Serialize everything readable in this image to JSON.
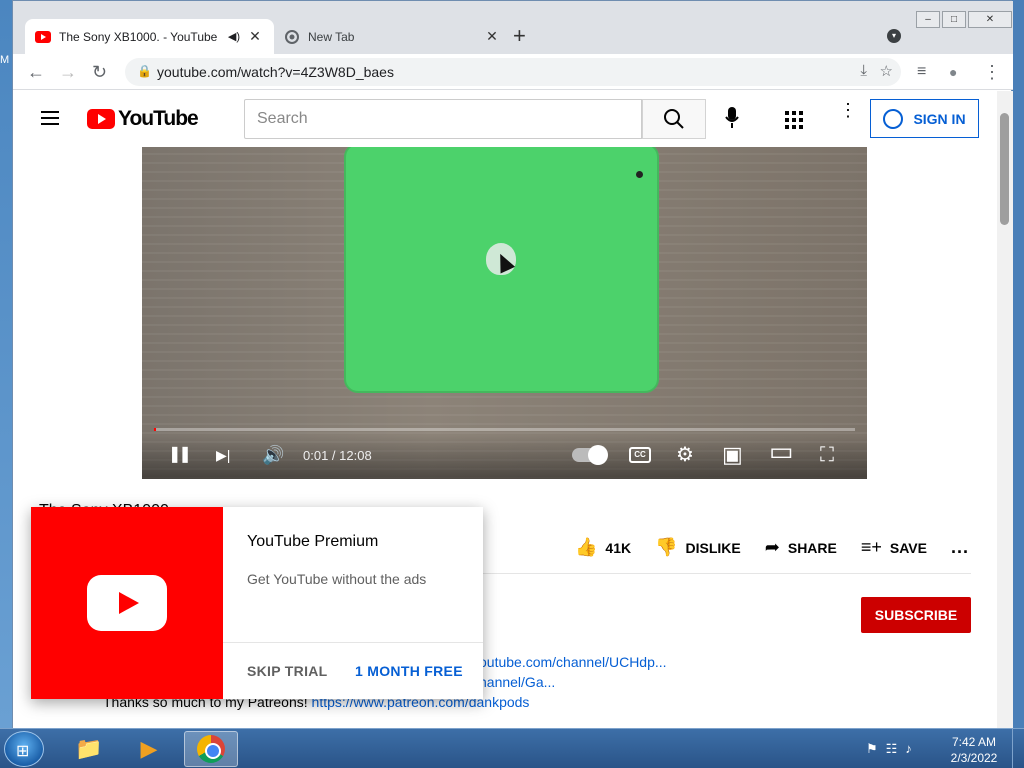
{
  "desktop": {
    "edge_letter": "M"
  },
  "browser": {
    "tabs": [
      {
        "title": "The Sony XB1000. - YouTube",
        "active": true,
        "audio": "◀)",
        "close": "✕"
      },
      {
        "title": "New Tab",
        "active": false,
        "close": "✕"
      }
    ],
    "new_tab": "+",
    "tab_search": "▾",
    "window_controls": {
      "minimize": "–",
      "maximize": "□",
      "close": "✕"
    },
    "nav": {
      "back": "←",
      "forward": "→",
      "reload": "↻"
    },
    "address": {
      "lock": "🔒",
      "url": "youtube.com/watch?v=4Z3W8D_baes",
      "install": "⤓",
      "star": "☆"
    },
    "right_icons": {
      "media": "≡",
      "profile": "●",
      "menu": "⋮"
    }
  },
  "youtube": {
    "logo_text": "YouTube",
    "search_placeholder": "Search",
    "search_icon": "⚲",
    "mic_icon": "🎤",
    "more_icon": "⋮",
    "sign_in": "SIGN IN",
    "player": {
      "time": "0:01 / 12:08",
      "progress": 0.002,
      "pause_icon": "❚❚",
      "next_icon": "▶|",
      "volume_icon": "🔊",
      "cc_label": "CC",
      "settings_icon": "⚙",
      "miniplayer_icon": "▣",
      "theater_icon": "▭",
      "fullscreen_icon": "⛶"
    },
    "video_title": "The Sony XB1000.",
    "actions": [
      {
        "icon": "👍",
        "label": "41K"
      },
      {
        "icon": "👎",
        "label": "DISLIKE"
      },
      {
        "icon": "➦",
        "label": "SHARE"
      },
      {
        "icon": "≡+",
        "label": "SAVE"
      }
    ],
    "more_actions": "...",
    "subscribe": "SUBSCRIBE",
    "description": {
      "link1": "outube.com/channel/UCHdp...",
      "link2": "hannel/Ga...",
      "patreon_text": "Thanks so much to my Patreons! ",
      "patreon_link": "https://www.patreon.com/dankpods"
    }
  },
  "promo": {
    "title": "YouTube Premium",
    "subtitle": "Get YouTube without the ads",
    "skip": "SKIP TRIAL",
    "free": "1 MONTH FREE"
  },
  "taskbar": {
    "start_icon": "⊞",
    "apps": [
      {
        "name": "explorer",
        "icon": "📁"
      },
      {
        "name": "media-player",
        "icon": "▶"
      },
      {
        "name": "chrome",
        "icon": ""
      }
    ],
    "tray": {
      "flag": "⚑",
      "network": "☷",
      "volume": "♪"
    },
    "time": "7:42 AM",
    "date": "2/3/2022"
  }
}
